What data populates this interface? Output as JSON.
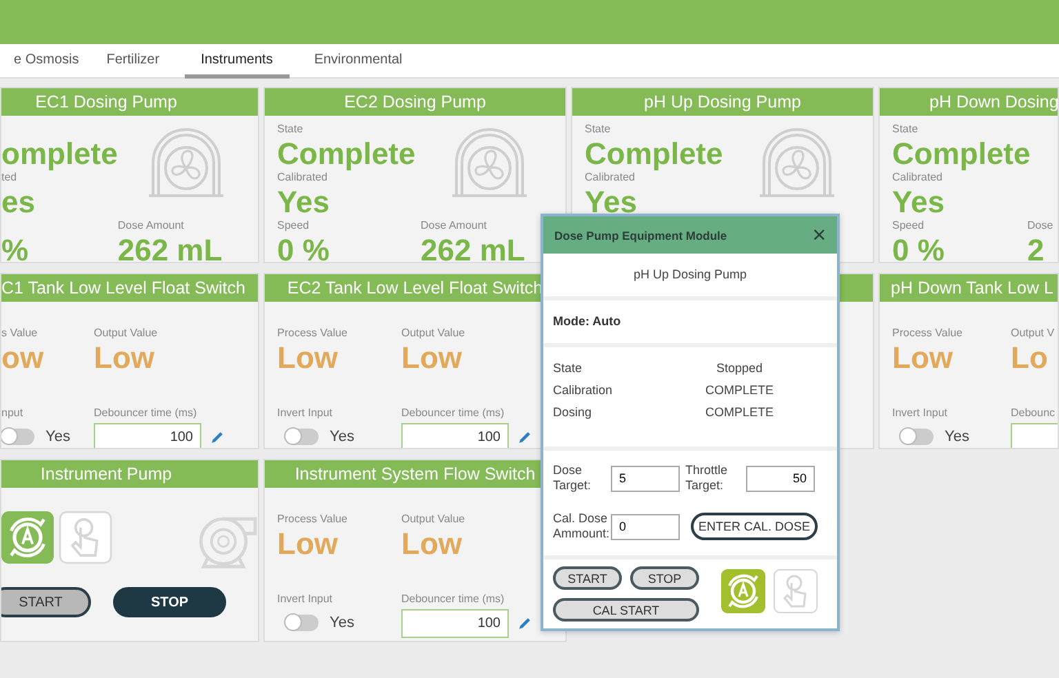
{
  "tabs": [
    {
      "label": "e Osmosis",
      "selected": false
    },
    {
      "label": "Fertilizer",
      "selected": false
    },
    {
      "label": "Instruments",
      "selected": true
    },
    {
      "label": "Environmental",
      "selected": false
    }
  ],
  "dosing_pumps": [
    {
      "title": "EC1 Dosing Pump",
      "state": "omplete",
      "calibrated_label": "ted",
      "calibrated": "es",
      "speed": "%",
      "dose_label": "Dose Amount",
      "dose": "262 mL",
      "graphic": true
    },
    {
      "title": "EC2 Dosing Pump",
      "state_label": "State",
      "state": "Complete",
      "calibrated_label": "Calibrated",
      "calibrated": "Yes",
      "speed_label": "Speed",
      "speed": "0 %",
      "dose_label": "Dose Amount",
      "dose": "262 mL",
      "graphic": true
    },
    {
      "title": "pH Up Dosing Pump",
      "state_label": "State",
      "state": "Complete",
      "calibrated_label": "Calibrated",
      "calibrated": "Yes",
      "graphic": true
    },
    {
      "title": "pH Down Dosing",
      "state_label": "State",
      "state": "Complete",
      "calibrated_label": "Calibrated",
      "calibrated": "Yes",
      "speed_label": "Speed",
      "speed": "0 %",
      "dose_label": "Dose",
      "dose": "2",
      "graphic": false
    }
  ],
  "float_switches": [
    {
      "title": "C1 Tank Low Level Float Switch",
      "process_label": "s Value",
      "process_value": "ow",
      "output_label": "Output Value",
      "output_value": "Low",
      "invert_label": "nput",
      "invert_on": false,
      "invert_text": "Yes",
      "debounce_label": "Debouncer time (ms)",
      "debounce_value": "100"
    },
    {
      "title": "EC2 Tank Low Level Float Switch",
      "process_label": "Process Value",
      "process_value": "Low",
      "output_label": "Output Value",
      "output_value": "Low",
      "invert_label": "Invert Input",
      "invert_on": false,
      "invert_text": "Yes",
      "debounce_label": "Debouncer time (ms)",
      "debounce_value": "100"
    },
    {
      "title": "pH Down Tank Low L",
      "process_label": "Process Value",
      "process_value": "Low",
      "output_label": "Output V",
      "output_value": "Lo",
      "invert_label": "Invert Input",
      "invert_on": false,
      "invert_text": "Yes",
      "debounce_label": "Debounc"
    }
  ],
  "instrument_pump": {
    "title": "Instrument Pump",
    "modes": [
      {
        "kind": "auto",
        "selected": true
      },
      {
        "kind": "manual",
        "selected": false
      }
    ],
    "buttons": [
      {
        "label": "START",
        "active": false
      },
      {
        "label": "STOP",
        "active": true
      }
    ]
  },
  "flow_switch": {
    "title": "Instrument System Flow Switch",
    "process_label": "Process Value",
    "process_value": "Low",
    "output_label": "Output Value",
    "output_value": "Low",
    "invert_label": "Invert Input",
    "invert_on": false,
    "invert_text": "Yes",
    "debounce_label": "Debouncer time (ms)",
    "debounce_value": "100"
  },
  "dialog": {
    "title": "Dose Pump Equipment Module",
    "close": "×",
    "pump_name": "pH Up Dosing Pump",
    "mode": "Mode: Auto",
    "status": [
      {
        "label": "State",
        "value": "Stopped"
      },
      {
        "label": "Calibration",
        "value": "COMPLETE"
      },
      {
        "label": "Dosing",
        "value": "COMPLETE"
      }
    ],
    "targets": [
      {
        "label": "Dose Target:",
        "value": "5"
      },
      {
        "label": "Throttle Target:",
        "value": "50"
      }
    ],
    "cal_label": "Cal. Dose Ammount:",
    "cal_value": "0",
    "cal_button": "ENTER CAL. DOSE",
    "buttons": [
      "START",
      "STOP",
      "CAL START"
    ],
    "modes": [
      {
        "kind": "auto",
        "selected": true
      },
      {
        "kind": "manual",
        "selected": false
      }
    ]
  }
}
